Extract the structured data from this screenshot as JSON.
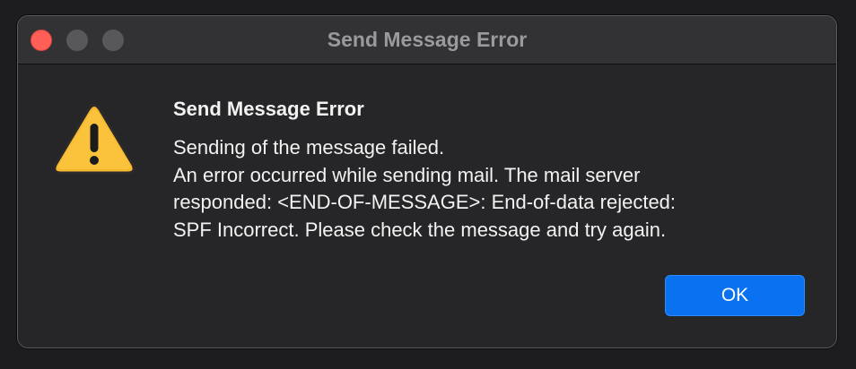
{
  "window": {
    "title": "Send Message Error"
  },
  "dialog": {
    "icon": "warning-triangle-icon",
    "heading": "Send Message Error",
    "message_lines": [
      "Sending of the message failed.",
      "An error occurred while sending mail. The mail server",
      "responded:  <END-OF-MESSAGE>: End-of-data rejected:",
      "SPF Incorrect. Please check the message and try again."
    ],
    "ok_label": "OK"
  },
  "colors": {
    "accent": "#0a72f0",
    "close_button": "#ff5f57",
    "warning": "#f7b731"
  }
}
